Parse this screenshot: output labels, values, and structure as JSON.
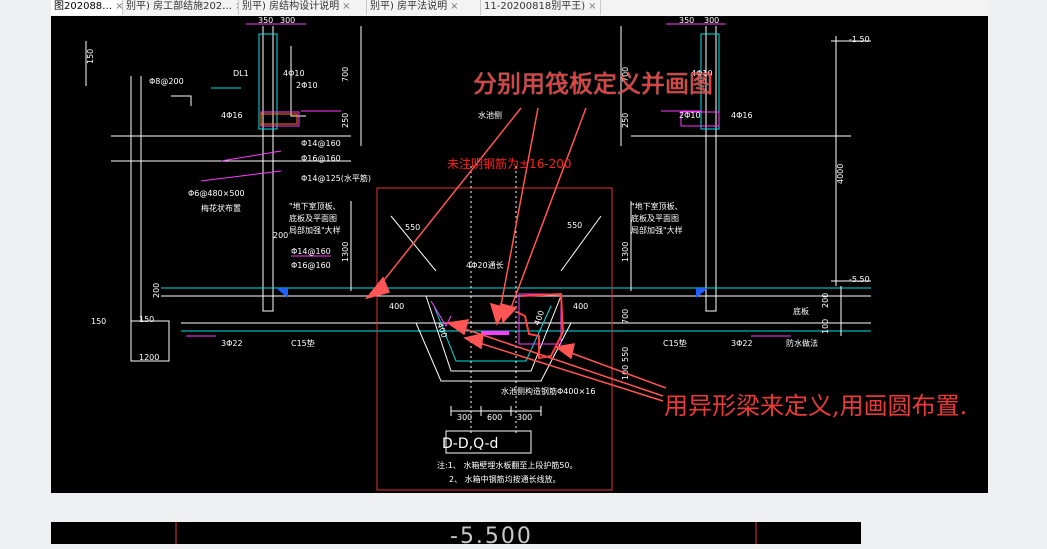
{
  "tabs": [
    {
      "label": "图202088…",
      "active": true
    },
    {
      "label": "别平)  房工部结施202…",
      "active": false
    },
    {
      "label": "别平)  房结构设计说明",
      "active": false
    },
    {
      "label": "别平)  房平法说明",
      "active": false
    },
    {
      "label": "11-20200818别平王)",
      "active": false
    }
  ],
  "annotations": {
    "top": "分别用筏板定义并画图",
    "bottom": "用异形梁来定义,用画圆布置.",
    "red_note": "未注明钢筋为±16-200"
  },
  "drawing": {
    "section_title": "D-D,Q-d",
    "notes": [
      "注:1、 水箱壁埋水板翻至上段护筋50。",
      "2、 水箱中钢筋均按通长线放。"
    ],
    "elevations": [
      "-1.50",
      "-5.50"
    ],
    "dims_top": [
      "350",
      "300",
      "350",
      "300"
    ],
    "dims_left_vertical": [
      "150",
      "700",
      "250",
      "1300",
      "200",
      "150"
    ],
    "dims_right_vertical": [
      "700",
      "250",
      "4000",
      "1300",
      "200",
      "100"
    ],
    "dims_center_bottom": [
      "300",
      "600",
      "300"
    ],
    "dims_center": [
      "400",
      "400",
      "400",
      "400",
      "700",
      "550",
      "100",
      "200",
      "550",
      "550"
    ],
    "rebar_labels_left": [
      "Φ8@200",
      "DL1",
      "4Φ10",
      "2Φ10",
      "4Φ16",
      "Φ14@160",
      "Φ16@160",
      "Φ14@125(水平筋)",
      "Φ6@480×500",
      "梅花状布置",
      "Φ14@160",
      "Φ16@160",
      "200",
      "3Φ22",
      "C15垫"
    ],
    "rebar_labels_right": [
      "4Φ10",
      "2Φ10",
      "4Φ16",
      "3Φ22",
      "C15垫",
      "底板",
      "防水做法"
    ],
    "center_labels": [
      "水池侧",
      "4Φ20通长",
      "水池侧构造钢筋Φ400×16",
      "50"
    ],
    "note_left": [
      "\"地下室顶板、",
      "底板及平面图",
      "局部加强\"大样"
    ],
    "note_right": [
      "\"地下室顶板、",
      "底板及平面图",
      "局部加强\"大样"
    ],
    "left_misc": [
      "150",
      "150",
      "1200"
    ],
    "bottom_title_2": "-5.500"
  },
  "colors": {
    "cad_bg": "#000000",
    "magenta": "#ff3cff",
    "white": "#ffffff",
    "cyan": "#00e0e0",
    "yellow": "#ffff40",
    "red": "#e83a3a",
    "green": "#3cff3c"
  }
}
